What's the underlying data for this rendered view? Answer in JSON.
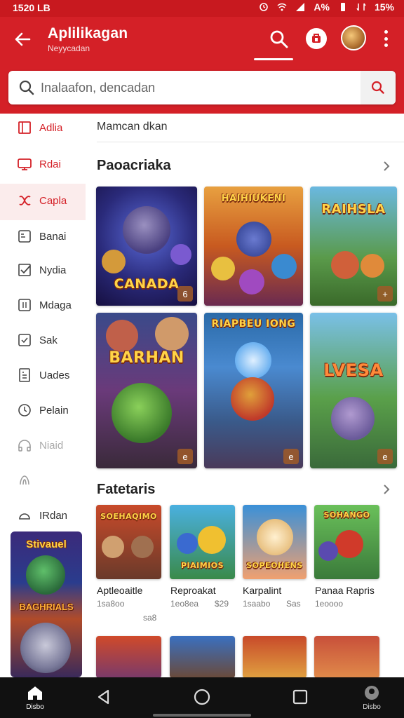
{
  "status_bar": {
    "time": "1520 LB",
    "battery": "A%",
    "battery_right": "15%"
  },
  "app_bar": {
    "title": "Aplilikagan",
    "subtitle": "Neyycadan"
  },
  "search": {
    "placeholder": "Inalaafon, dencadan"
  },
  "sidebar": {
    "items": [
      {
        "label": "Adlia",
        "icon": "square-icon",
        "style": "red"
      },
      {
        "label": "Rdai",
        "icon": "monitor-icon",
        "style": "red"
      },
      {
        "label": "Capla",
        "icon": "puzzle-icon",
        "style": "red"
      },
      {
        "label": "Banai",
        "icon": "image-icon",
        "style": "normal"
      },
      {
        "label": "Nydia",
        "icon": "checkbox-icon",
        "style": "normal"
      },
      {
        "label": "Mdaga",
        "icon": "book-icon",
        "style": "normal"
      },
      {
        "label": "Sak",
        "icon": "chat-icon",
        "style": "normal"
      },
      {
        "label": "Uades",
        "icon": "doc-icon",
        "style": "normal"
      },
      {
        "label": "Pelain",
        "icon": "clock-icon",
        "style": "normal"
      },
      {
        "label": "Niaid",
        "icon": "headphones-icon",
        "style": "faded"
      },
      {
        "label": "",
        "icon": "star-icon",
        "style": "faded"
      },
      {
        "label": "IRdan",
        "icon": "circle-icon",
        "style": "normal"
      }
    ],
    "promo": {
      "title": "Stivauel",
      "subtitle": "BAGHRIALS"
    }
  },
  "main": {
    "breadcrumb": "Mamcan dkan",
    "section1": {
      "title": "Paoacriaka",
      "cards": [
        {
          "title": "CANADA",
          "badge": "6"
        },
        {
          "title": "HAIHIUKENI",
          "badge": ""
        },
        {
          "title": "RAIHSLA",
          "badge": "+"
        },
        {
          "title": "BARHAN",
          "badge": "e"
        },
        {
          "title": "RIAPBEU IONG",
          "badge": "e"
        },
        {
          "title": "LVESA",
          "badge": "e"
        }
      ]
    },
    "section2": {
      "title": "Fatetaris",
      "apps": [
        {
          "name": "Aptleoaitle",
          "meta1": "1sa8oo",
          "meta2": "sa8"
        },
        {
          "name": "Reproakat",
          "meta1": "1eo8ea",
          "meta2": "$29"
        },
        {
          "name": "Karpalint",
          "meta1": "1saabo",
          "meta2": "Sas"
        },
        {
          "name": "Panaa Rapris",
          "meta1": "1eoooo",
          "meta2": ""
        }
      ],
      "card_titles": [
        "SOEHAQIMO",
        "PIAIMIOS",
        "SOPEOHENS",
        "SOHANGO"
      ]
    }
  },
  "nav": {
    "home_label": "Disbo",
    "right_label": "Disbo"
  },
  "colors": {
    "brand": "#d42027",
    "brand_dark": "#c8191f",
    "navbar": "#111111"
  }
}
